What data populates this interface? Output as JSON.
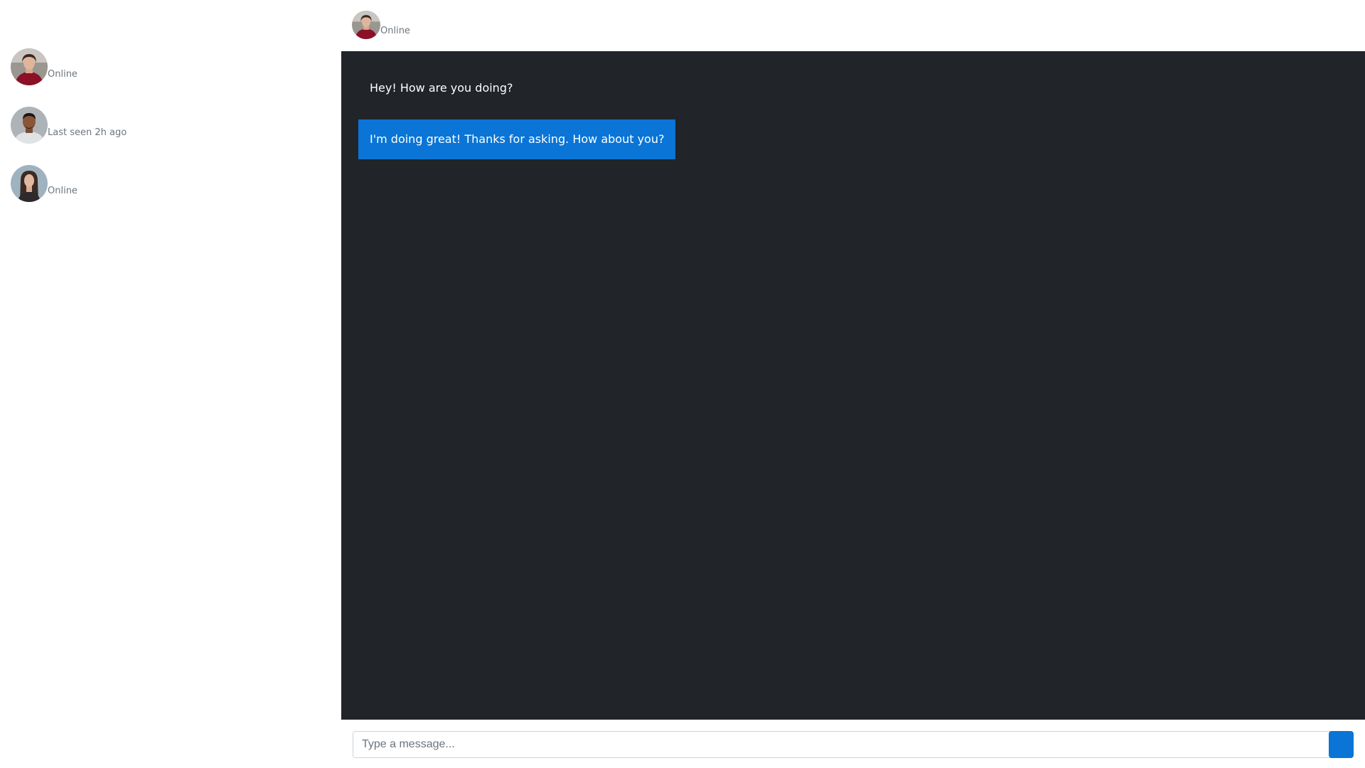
{
  "sidebar": {
    "contacts": [
      {
        "status": "Online"
      },
      {
        "status": "Last seen 2h ago"
      },
      {
        "status": "Online"
      }
    ]
  },
  "header": {
    "status": "Online"
  },
  "messages": [
    {
      "direction": "received",
      "text": "Hey! How are you doing?"
    },
    {
      "direction": "sent",
      "text": "I'm doing great! Thanks for asking. How about you?"
    }
  ],
  "composer": {
    "placeholder": "Type a message...",
    "value": ""
  },
  "colors": {
    "chat_background": "#212429",
    "sent_bubble": "#0a75d6",
    "send_button": "#0a75d6",
    "status_text": "#6c757d"
  },
  "icons": {
    "send_button": "send-icon"
  }
}
